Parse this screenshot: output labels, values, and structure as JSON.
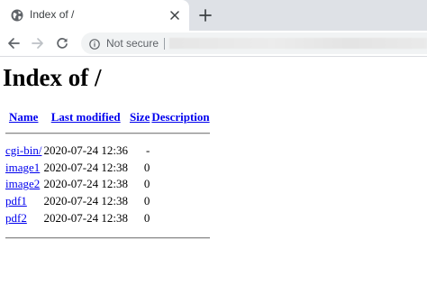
{
  "browser": {
    "tab": {
      "title": "Index of /"
    },
    "omnibox": {
      "security_label": "Not secure"
    },
    "colors": {
      "tabstrip": "#dee1e6",
      "link": "#0000ee"
    }
  },
  "page": {
    "title": "Index of /",
    "headers": {
      "name": "Name",
      "last_modified": "Last modified",
      "size": "Size",
      "description": "Description"
    },
    "entries": [
      {
        "name": "cgi-bin/",
        "modified": "2020-07-24 12:36",
        "size": "-",
        "description": ""
      },
      {
        "name": "image1",
        "modified": "2020-07-24 12:38",
        "size": "0",
        "description": ""
      },
      {
        "name": "image2",
        "modified": "2020-07-24 12:38",
        "size": "0",
        "description": ""
      },
      {
        "name": "pdf1",
        "modified": "2020-07-24 12:38",
        "size": "0",
        "description": ""
      },
      {
        "name": "pdf2",
        "modified": "2020-07-24 12:38",
        "size": "0",
        "description": ""
      }
    ]
  }
}
